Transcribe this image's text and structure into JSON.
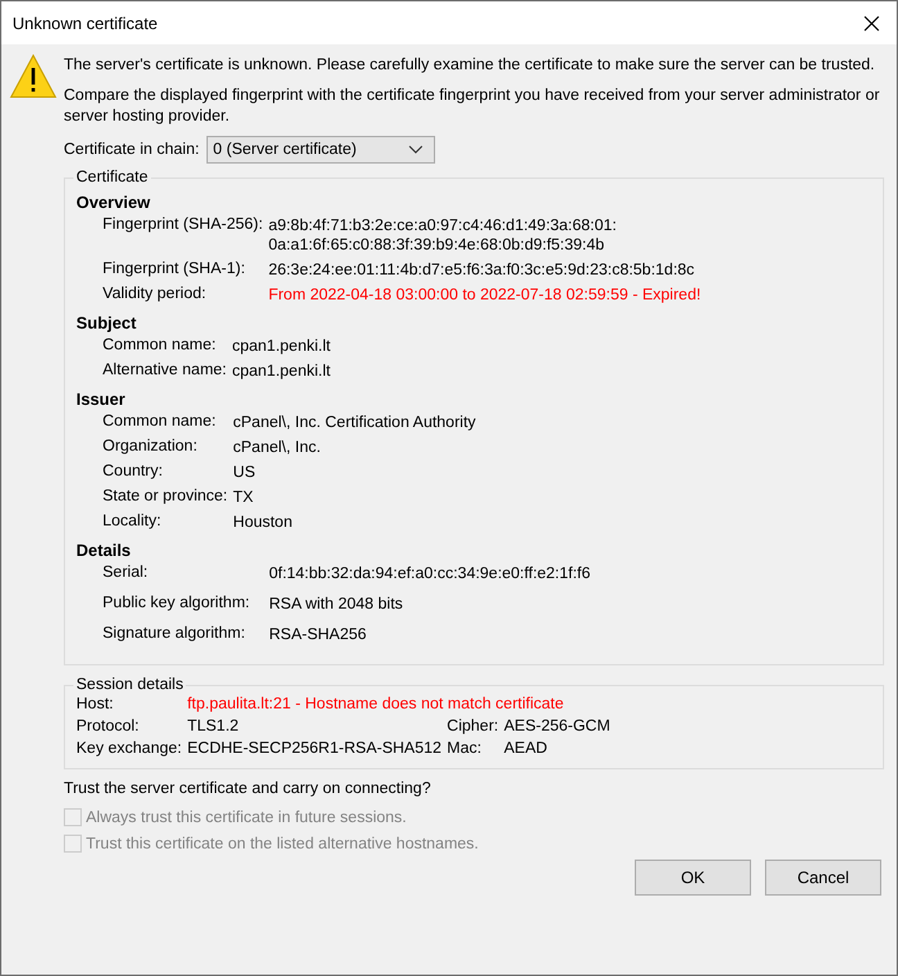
{
  "window": {
    "title": "Unknown certificate"
  },
  "intro": [
    "The server's certificate is unknown. Please carefully examine the certificate to make sure the server can be trusted.",
    "Compare the displayed fingerprint with the certificate fingerprint you have received from your server administrator or server hosting provider."
  ],
  "chain": {
    "label": "Certificate in chain:",
    "value": "0 (Server certificate)"
  },
  "certificate": {
    "title": "Certificate",
    "sections": [
      {
        "title": "Overview",
        "rows": [
          {
            "label": "Fingerprint (SHA-256):",
            "values": [
              "a9:8b:4f:71:b3:2e:ce:a0:97:c4:46:d1:49:3a:68:01:",
              "0a:a1:6f:65:c0:88:3f:39:b9:4e:68:0b:d9:f5:39:4b"
            ],
            "alert": false
          },
          {
            "label": "Fingerprint (SHA-1):",
            "values": [
              "26:3e:24:ee:01:11:4b:d7:e5:f6:3a:f0:3c:e5:9d:23:c8:5b:1d:8c"
            ],
            "alert": false
          },
          {
            "label": "Validity period:",
            "values": [
              "From 2022-04-18 03:00:00 to 2022-07-18 02:59:59 - Expired!"
            ],
            "alert": true
          }
        ]
      },
      {
        "title": "Subject",
        "rows": [
          {
            "label": "Common name:",
            "values": [
              "cpan1.penki.lt"
            ],
            "alert": false
          },
          {
            "label": "Alternative name:",
            "values": [
              "cpan1.penki.lt"
            ],
            "alert": false
          }
        ]
      },
      {
        "title": "Issuer",
        "rows": [
          {
            "label": "Common name:",
            "values": [
              "cPanel\\, Inc. Certification Authority"
            ],
            "alert": false
          },
          {
            "label": "Organization:",
            "values": [
              "cPanel\\, Inc."
            ],
            "alert": false
          },
          {
            "label": "Country:",
            "values": [
              "US"
            ],
            "alert": false
          },
          {
            "label": "State or province:",
            "values": [
              "TX"
            ],
            "alert": false
          },
          {
            "label": "Locality:",
            "values": [
              "Houston"
            ],
            "alert": false
          }
        ]
      },
      {
        "title": "Details",
        "rows": [
          {
            "label": "Serial:",
            "values": [
              "0f:14:bb:32:da:94:ef:a0:cc:34:9e:e0:ff:e2:1f:f6"
            ],
            "alert": false
          },
          {
            "label": "Public key algorithm:",
            "values": [
              "RSA with 2048 bits"
            ],
            "alert": false
          },
          {
            "label": "Signature algorithm:",
            "values": [
              "RSA-SHA256"
            ],
            "alert": false
          }
        ]
      }
    ]
  },
  "session": {
    "title": "Session details",
    "host": {
      "label": "Host:",
      "value": "ftp.paulita.lt:21 - Hostname does not match certificate",
      "alert": true
    },
    "pairs": [
      [
        {
          "label": "Protocol:",
          "value": "TLS1.2"
        },
        {
          "label": "Cipher:",
          "value": "AES-256-GCM"
        }
      ],
      [
        {
          "label": "Key exchange:",
          "value": "ECDHE-SECP256R1-RSA-SHA512"
        },
        {
          "label": "Mac:",
          "value": "AEAD"
        }
      ]
    ]
  },
  "question": "Trust the server certificate and carry on connecting?",
  "options": [
    {
      "label": "Always trust this certificate in future sessions.",
      "checked": false,
      "disabled": true
    },
    {
      "label": "Trust this certificate on the listed alternative hostnames.",
      "checked": false,
      "disabled": true
    }
  ],
  "buttons": [
    "OK",
    "Cancel"
  ]
}
